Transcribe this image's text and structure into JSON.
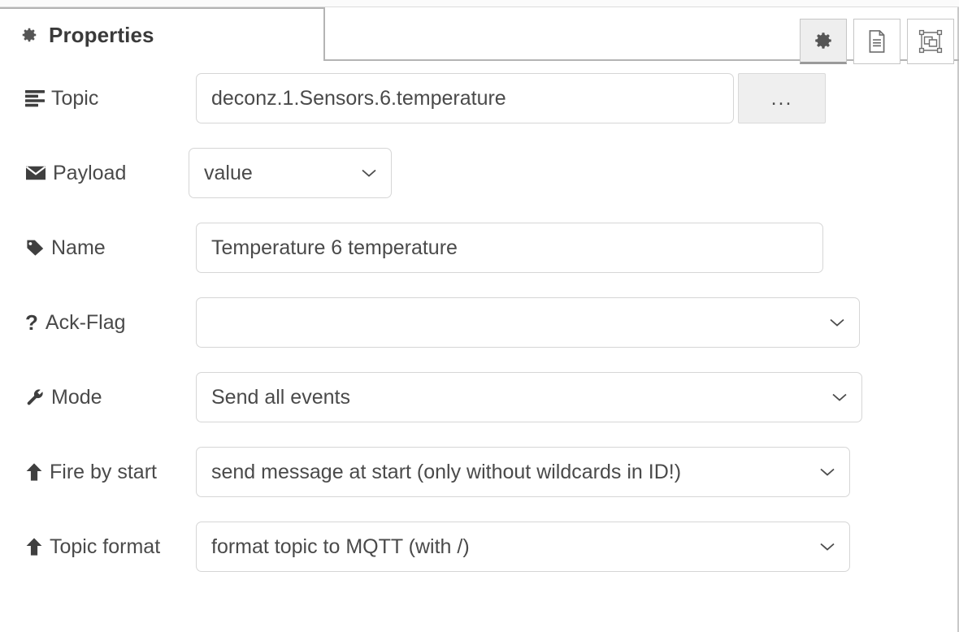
{
  "tab": {
    "label": "Properties",
    "icon": "gear-icon"
  },
  "toolbar": {
    "buttons": [
      {
        "name": "properties-view-button",
        "icon": "gear-icon",
        "active": true
      },
      {
        "name": "document-view-button",
        "icon": "document-icon",
        "active": false
      },
      {
        "name": "object-view-button",
        "icon": "object-select-icon",
        "active": false
      }
    ]
  },
  "fields": {
    "topic": {
      "label": "Topic",
      "icon": "list-icon",
      "value": "deconz.1.Sensors.6.temperature",
      "browse_label": "..."
    },
    "payload": {
      "label": "Payload",
      "icon": "envelope-icon",
      "value": "value"
    },
    "name": {
      "label": "Name",
      "icon": "tag-icon",
      "value": "Temperature 6 temperature"
    },
    "ack_flag": {
      "label": "Ack-Flag",
      "icon": "question-mark-icon",
      "value": ""
    },
    "mode": {
      "label": "Mode",
      "icon": "wrench-icon",
      "value": "Send all events"
    },
    "fire_by_start": {
      "label": "Fire by start",
      "icon": "arrow-up-icon",
      "value": "send message at start (only without wildcards in ID!)"
    },
    "topic_format": {
      "label": "Topic format",
      "icon": "arrow-up-icon",
      "value": "format topic to MQTT (with /)"
    }
  },
  "colors": {
    "text": "#4a4a4a",
    "heading": "#3a3a3a",
    "border": "#d6d6d6",
    "tab_border": "#b4b4b4",
    "button_bg": "#efefef",
    "active_tool_bg": "#eeeeee"
  }
}
